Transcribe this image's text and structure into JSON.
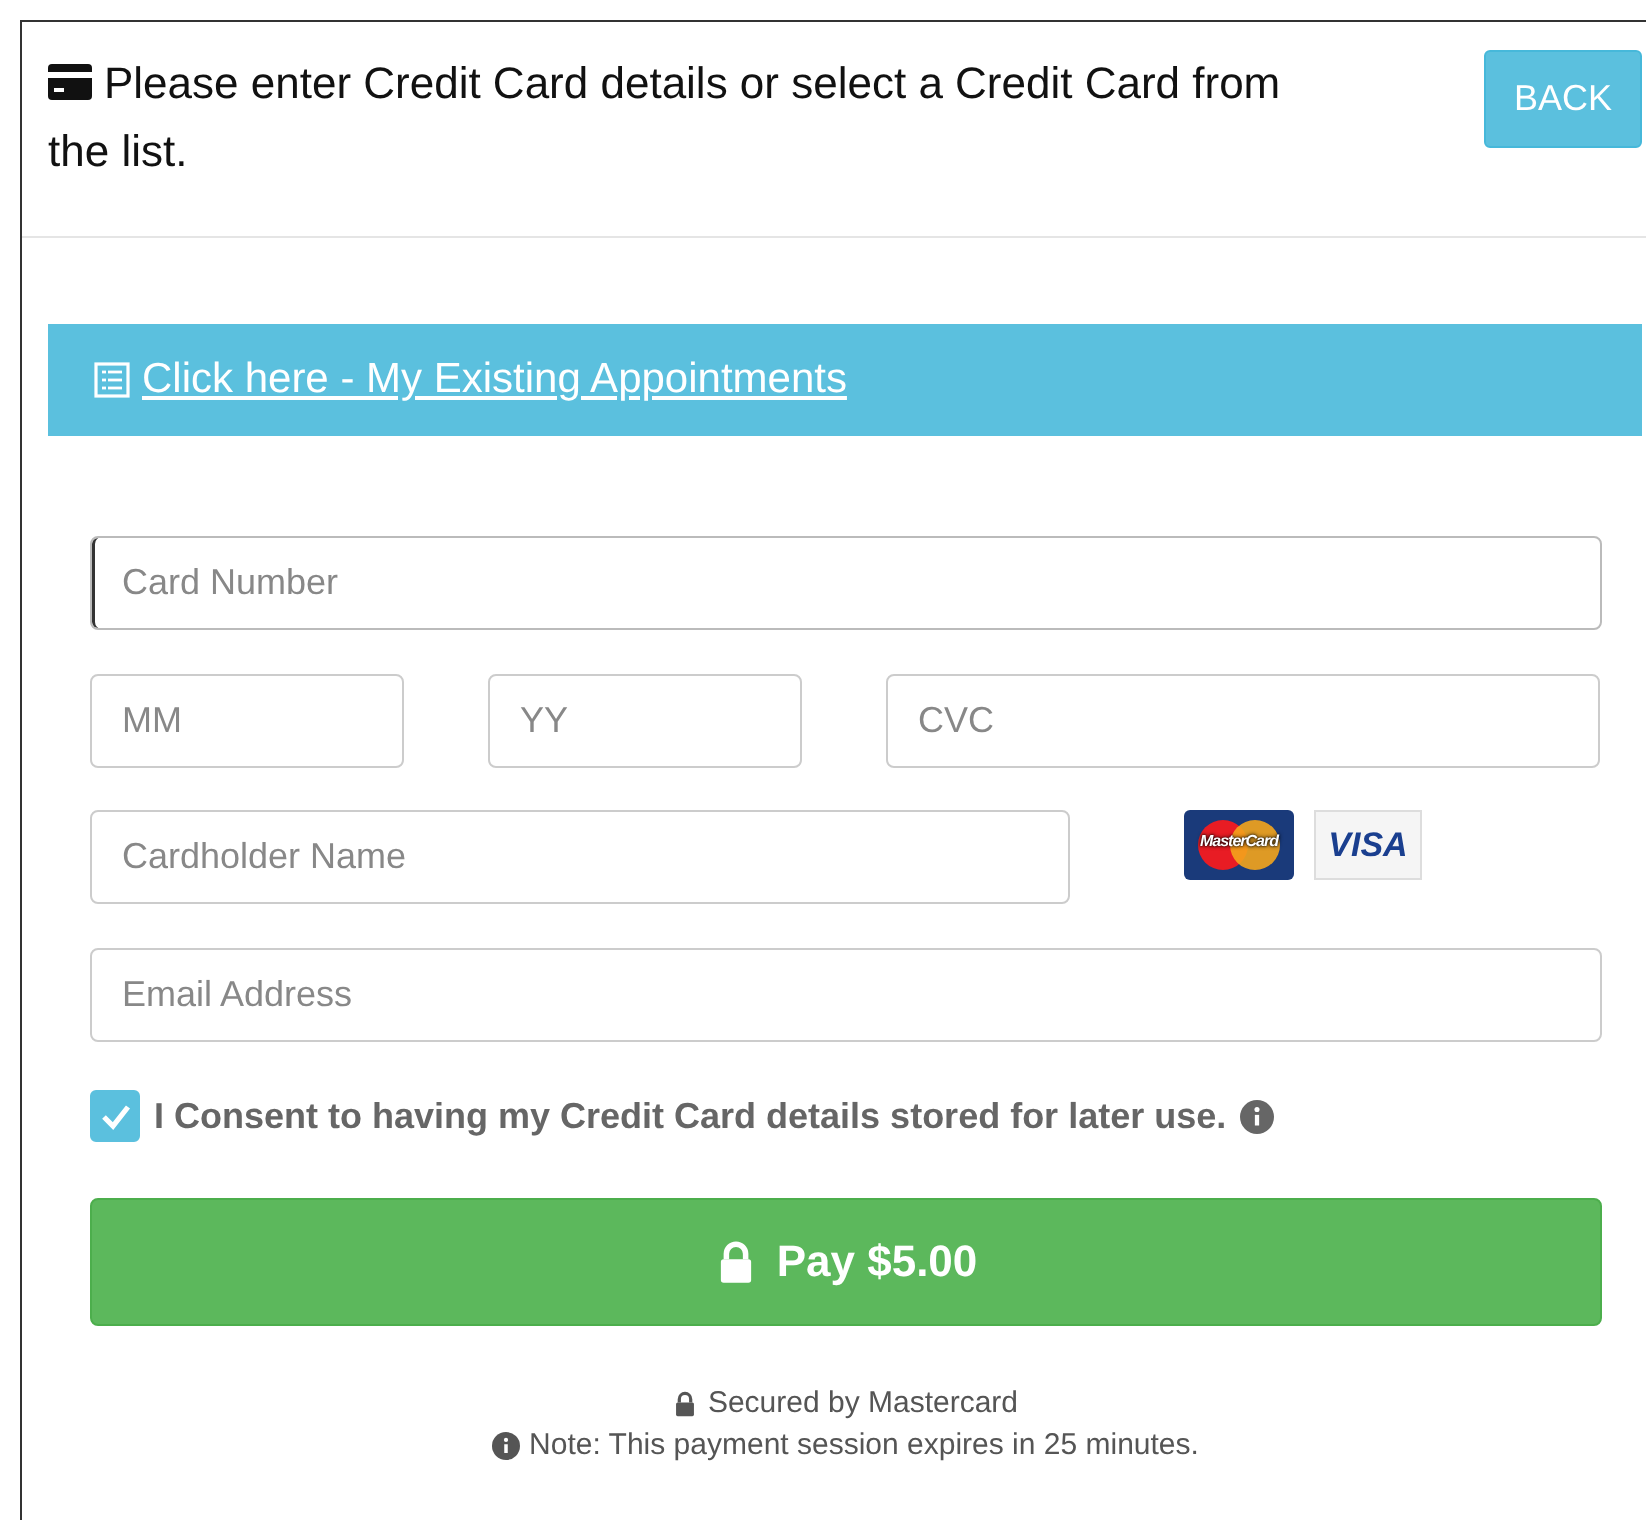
{
  "header": {
    "title": "Please enter Credit Card details or select a Credit Card from the list.",
    "back_button": "BACK"
  },
  "appointments_link": "Click here - My Existing Appointments",
  "fields": [
    {
      "placeholder": "Card Number",
      "focused": true
    },
    {
      "placeholder": "MM",
      "focused": false
    },
    {
      "placeholder": "YY",
      "focused": false
    },
    {
      "placeholder": "CVC",
      "focused": false
    },
    {
      "placeholder": "Cardholder Name",
      "focused": false
    },
    {
      "placeholder": "Email Address",
      "focused": false
    }
  ],
  "card_logos": [
    {
      "kind": "mastercard",
      "label": "MasterCard"
    },
    {
      "kind": "visa",
      "label": "VISA"
    }
  ],
  "consent": {
    "label": "I Consent to having my Credit Card details stored for later use.",
    "checked": true
  },
  "pay_button": "Pay $5.00",
  "footer": {
    "secured": "Secured by Mastercard",
    "note": "Note: This payment session expires in 25 minutes."
  }
}
